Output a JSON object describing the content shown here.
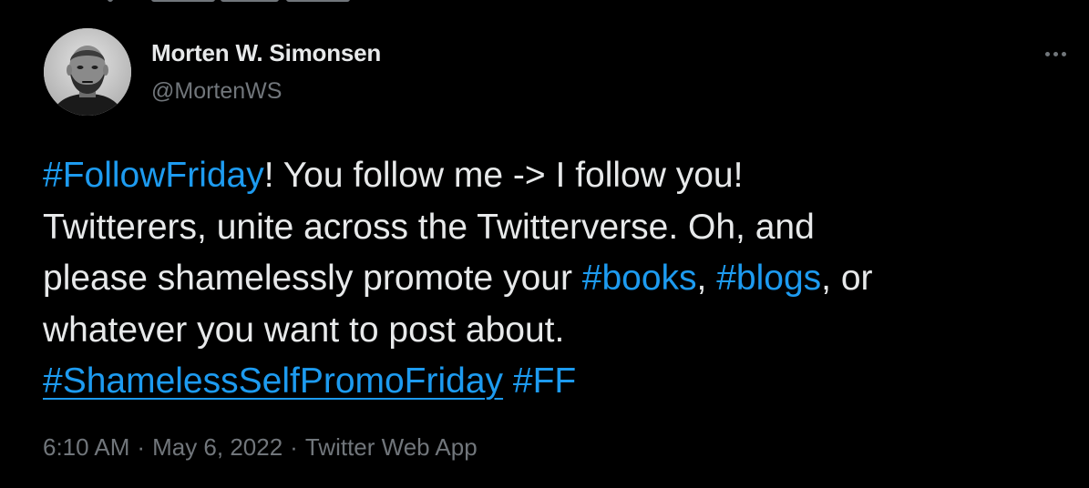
{
  "tweet": {
    "author": {
      "display_name": "Morten W. Simonsen",
      "handle": "@MortenWS"
    },
    "text": {
      "line1": {
        "tag_follow_friday": "#FollowFriday",
        "rest": "! You follow me -> I follow you!"
      },
      "line2": {
        "text": "Twitterers, unite across the Twitterverse. Oh, and"
      },
      "line3": {
        "before": "please shamelessly promote your ",
        "tag_books": "#books",
        "comma": ", ",
        "tag_blogs": "#blogs",
        "after": ", or"
      },
      "line4": {
        "text": "whatever you want to post about."
      },
      "line5": {
        "tag_shameless": "#ShamelessSelfPromoFriday",
        "space": " ",
        "tag_ff": "#FF"
      }
    },
    "meta": {
      "time": "6:10 AM",
      "separator": "·",
      "date": "May 6, 2022",
      "source": "Twitter Web App"
    }
  },
  "colors": {
    "background": "#000000",
    "text_primary": "#e7e9ea",
    "text_secondary": "#71767b",
    "link": "#1d9bf0"
  },
  "icons": {
    "more": "more-horizontal-icon"
  }
}
